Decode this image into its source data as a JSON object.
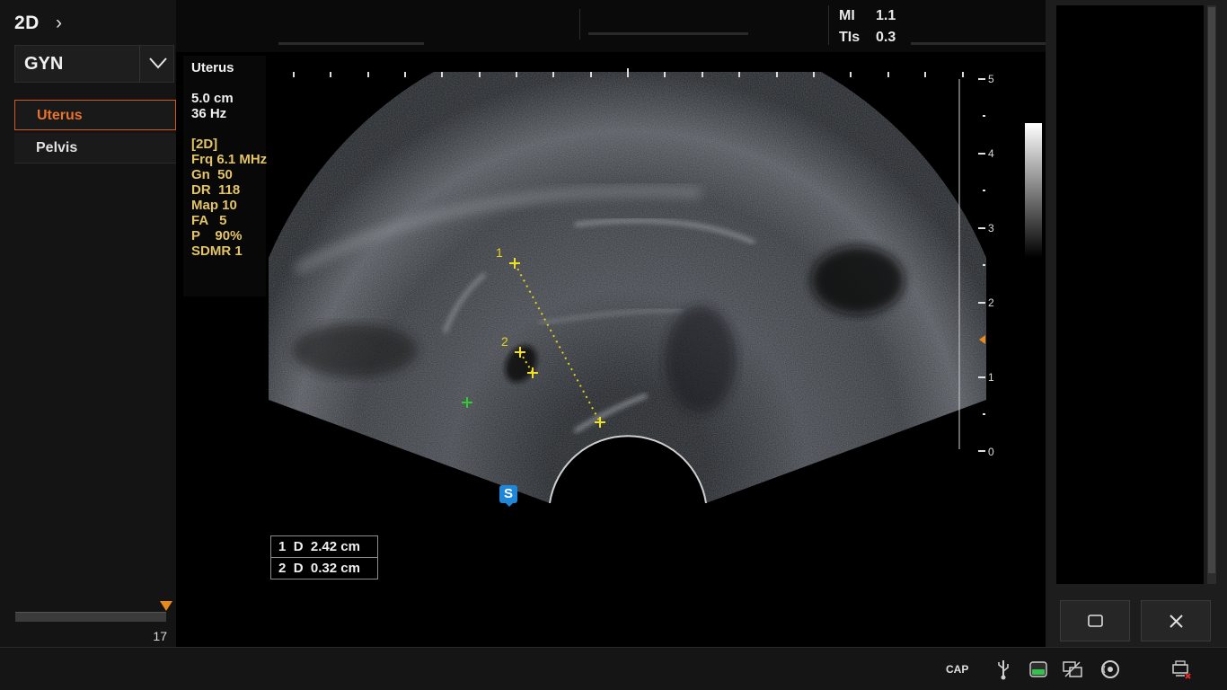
{
  "mode": {
    "label": "2D",
    "chevron": "›"
  },
  "preset": {
    "name": "GYN",
    "arrow_icon": "chevron-down-icon"
  },
  "exam_items": [
    {
      "label": "Uterus",
      "selected": true
    },
    {
      "label": "Pelvis",
      "selected": false
    }
  ],
  "frame": {
    "count": "17",
    "position_fraction": 1.0
  },
  "indices": {
    "mi_label": "MI",
    "mi_value": "1.1",
    "tis_label": "TIs",
    "tis_value": "0.3"
  },
  "params": {
    "exam": "Uterus",
    "depth": "5.0 cm",
    "frame_rate": "36 Hz",
    "mode": "[2D]",
    "frq": "Frq 6.1 MHz",
    "gn": "Gn  50",
    "dr": "DR  118",
    "map": "Map 10",
    "fa": "FA   5",
    "p": "P    90%",
    "sdmr": "SDMR 1"
  },
  "depth_scale": {
    "labels": [
      "5",
      "4",
      "3",
      "2",
      "1",
      "0"
    ]
  },
  "calipers": {
    "marker1": "1",
    "marker2": "2"
  },
  "measurements": [
    {
      "index": "1",
      "type": "D",
      "value": "2.42 cm"
    },
    {
      "index": "2",
      "type": "D",
      "value": "0.32 cm"
    }
  ],
  "s_badge": "S",
  "status_bar": {
    "cap_label": "CAP",
    "icons": [
      "usb-icon",
      "storage-icon",
      "network-icon",
      "disc-icon",
      "printer-icon"
    ]
  },
  "colors": {
    "accent": "#e8722e",
    "caliper": "#f0e020",
    "param_text": "#e3c466",
    "focus_marker": "#e88a1c",
    "s_badge": "#1f86d8"
  }
}
